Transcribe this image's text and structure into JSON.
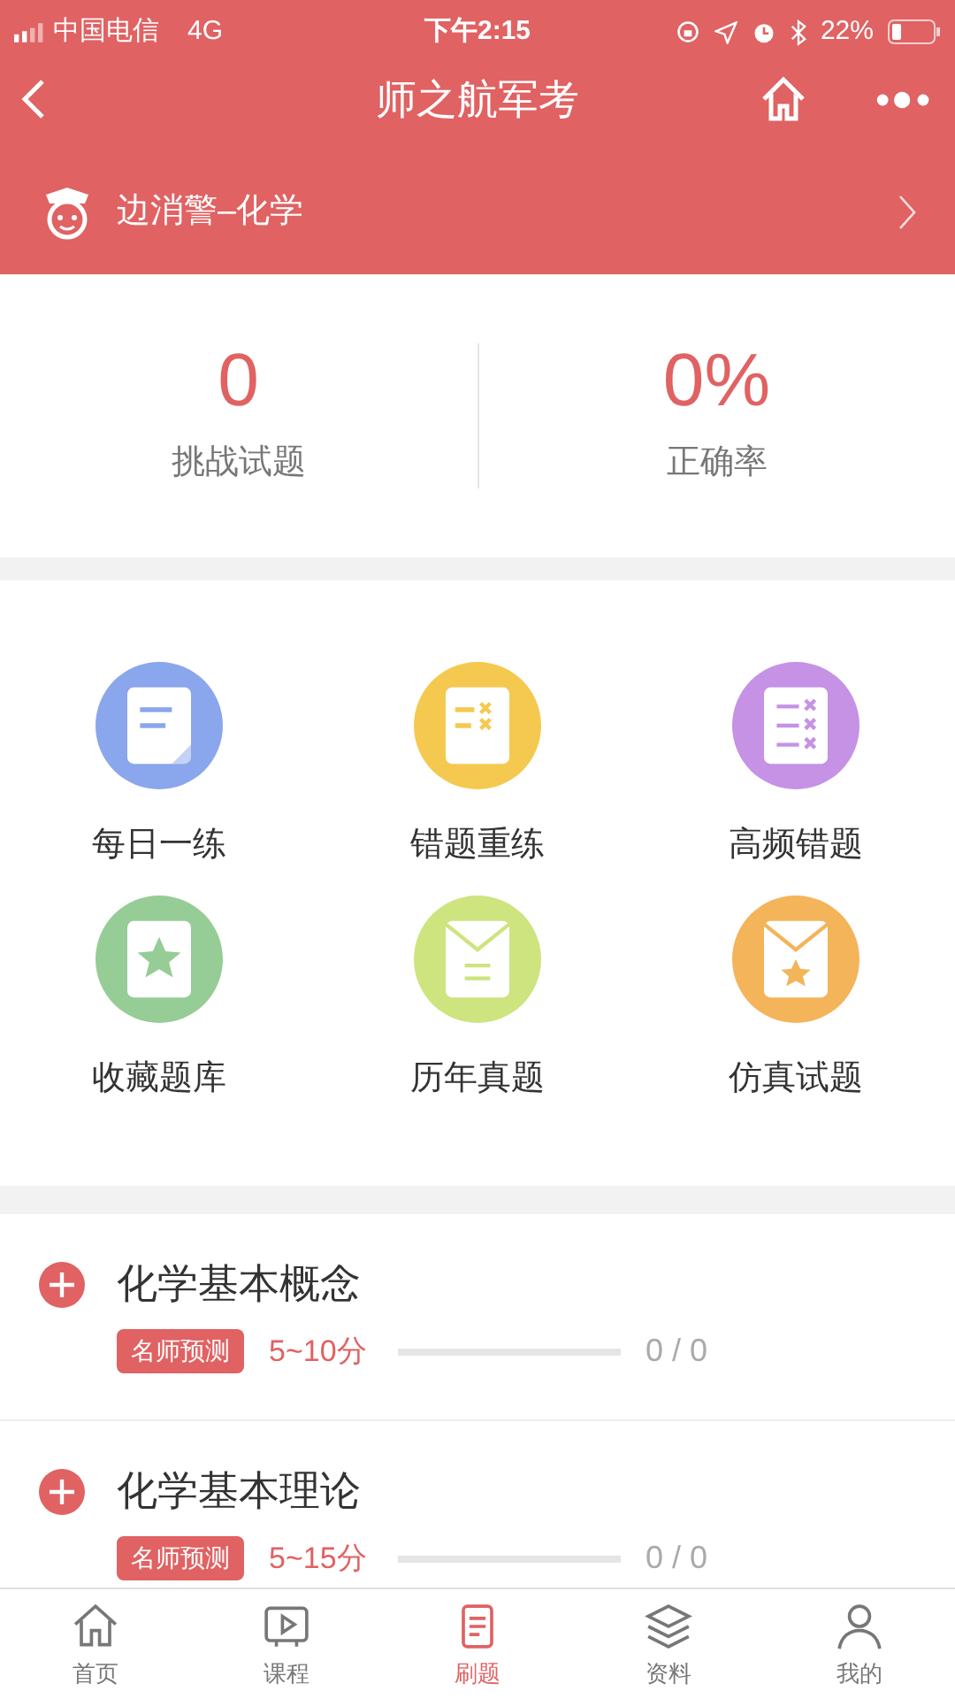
{
  "status_bar": {
    "carrier": "中国电信",
    "network": "4G",
    "time": "下午2:15",
    "battery": "22%"
  },
  "nav": {
    "title": "师之航军考"
  },
  "subject": {
    "label": "边消警–化学"
  },
  "stats": [
    {
      "value": "0",
      "label": "挑战试题"
    },
    {
      "value": "0%",
      "label": "正确率"
    }
  ],
  "features": [
    {
      "label": "每日一练",
      "color": "#8aa6ec",
      "kind": "notes"
    },
    {
      "label": "错题重练",
      "color": "#f5c94f",
      "kind": "mistakes"
    },
    {
      "label": "高频错题",
      "color": "#c592e6",
      "kind": "list"
    },
    {
      "label": "收藏题库",
      "color": "#96cc95",
      "kind": "star-book"
    },
    {
      "label": "历年真题",
      "color": "#cde47f",
      "kind": "envelope"
    },
    {
      "label": "仿真试题",
      "color": "#f3b45a",
      "kind": "star-envelope"
    }
  ],
  "chapters": [
    {
      "title": "化学基本概念",
      "tag": "名师预测",
      "score": "5~10分",
      "level": 0,
      "progress": "0 / 0"
    },
    {
      "title": "化学基本理论",
      "tag": "名师预测",
      "score": "5~15分",
      "level": 0,
      "progress": "0 / 0"
    }
  ],
  "tabs": [
    {
      "label": "首页",
      "kind": "home",
      "selected": false
    },
    {
      "label": "课程",
      "kind": "video",
      "selected": false
    },
    {
      "label": "刷题",
      "kind": "practice",
      "selected": true
    },
    {
      "label": "资料",
      "kind": "layers",
      "selected": false
    },
    {
      "label": "我的",
      "kind": "user",
      "selected": false
    }
  ]
}
